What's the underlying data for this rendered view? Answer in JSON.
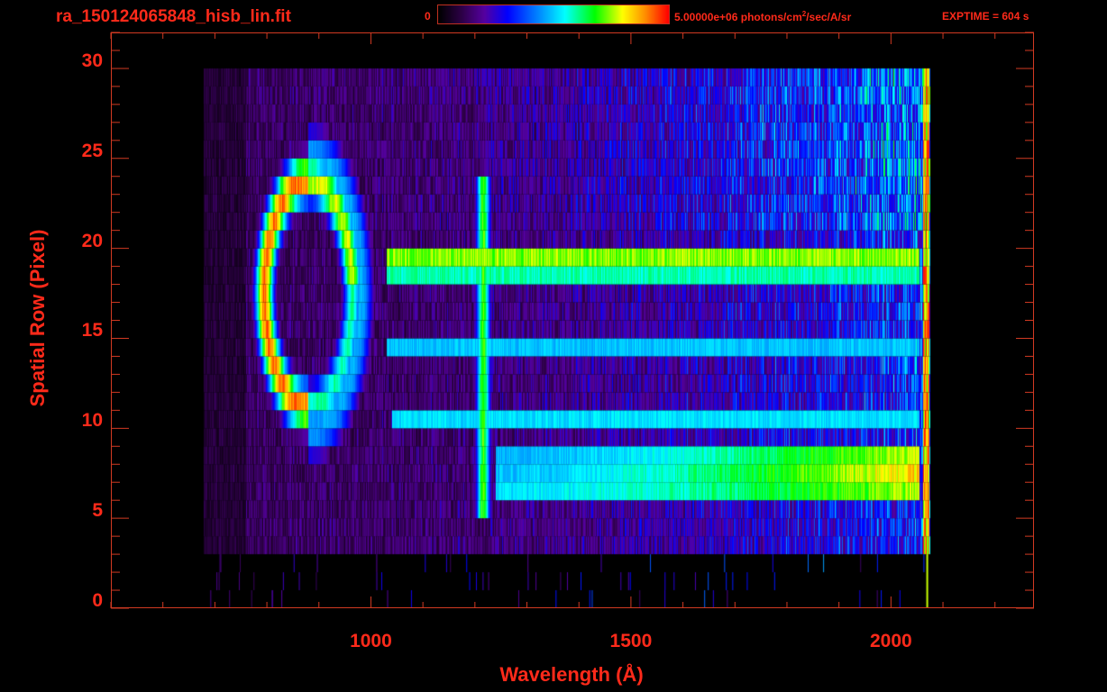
{
  "header": {
    "title": "ra_150124065848_hisb_lin.fit",
    "colorbar_min_label": "0",
    "colorbar_max_label": "5.00000e+06 photons/cm",
    "colorbar_max_sup": "2",
    "colorbar_max_suffix": "/sec/A/sr",
    "exptime": "EXPTIME = 604 s"
  },
  "colors": {
    "axis": "#ff2a1a",
    "background": "#000000"
  },
  "chart_data": {
    "type": "heatmap",
    "title": "ra_150124065848_hisb_lin.fit",
    "xlabel": "Wavelength (Å)",
    "ylabel": "Spatial Row (Pixel)",
    "xlim": [
      500,
      2275
    ],
    "ylim": [
      0,
      32
    ],
    "xticks": [
      1000,
      1500,
      2000
    ],
    "xtick_labels": [
      "1000",
      "1500",
      "2000"
    ],
    "x_minor_step": 100,
    "yticks": [
      0,
      5,
      10,
      15,
      20,
      25,
      30
    ],
    "ytick_labels": [
      "0",
      "5",
      "10",
      "15",
      "20",
      "25",
      "30"
    ],
    "y_minor_step": 1,
    "colorbar": {
      "min": 0,
      "max": 5000000,
      "units": "photons/cm^2/sec/A/sr",
      "colormap": "rainbow"
    },
    "data_extent": {
      "wavelength": [
        680,
        2075
      ],
      "rows": [
        3,
        30
      ]
    },
    "background_level": {
      "short_wavelength": 0.15,
      "long_wavelength": 0.5
    },
    "bands": [
      {
        "row": 19,
        "from": 1030,
        "to": 2055,
        "level": 0.78
      },
      {
        "row": 18,
        "from": 1030,
        "to": 2055,
        "level": 0.62
      },
      {
        "row": 14,
        "from": 1030,
        "to": 2055,
        "level": 0.52
      },
      {
        "row": 10,
        "from": 1040,
        "to": 2055,
        "level": 0.55
      },
      {
        "row": 8,
        "from": 1240,
        "to": 2055,
        "level": 0.5,
        "ramp_to": 0.82
      },
      {
        "row": 7,
        "from": 1240,
        "to": 2055,
        "level": 0.52,
        "ramp_to": 0.88
      },
      {
        "row": 6,
        "from": 1240,
        "to": 2055,
        "level": 0.55,
        "ramp_to": 0.8
      }
    ],
    "emission_line": {
      "wavelength": 1216,
      "rows": [
        5,
        23
      ],
      "level": 0.72
    },
    "ring": {
      "center_wavelength": 880,
      "center_row": 17.5,
      "radius_wavelength": 85,
      "radius_rows": 6.3,
      "level": 0.97
    },
    "edge_wavelength": 2068
  }
}
